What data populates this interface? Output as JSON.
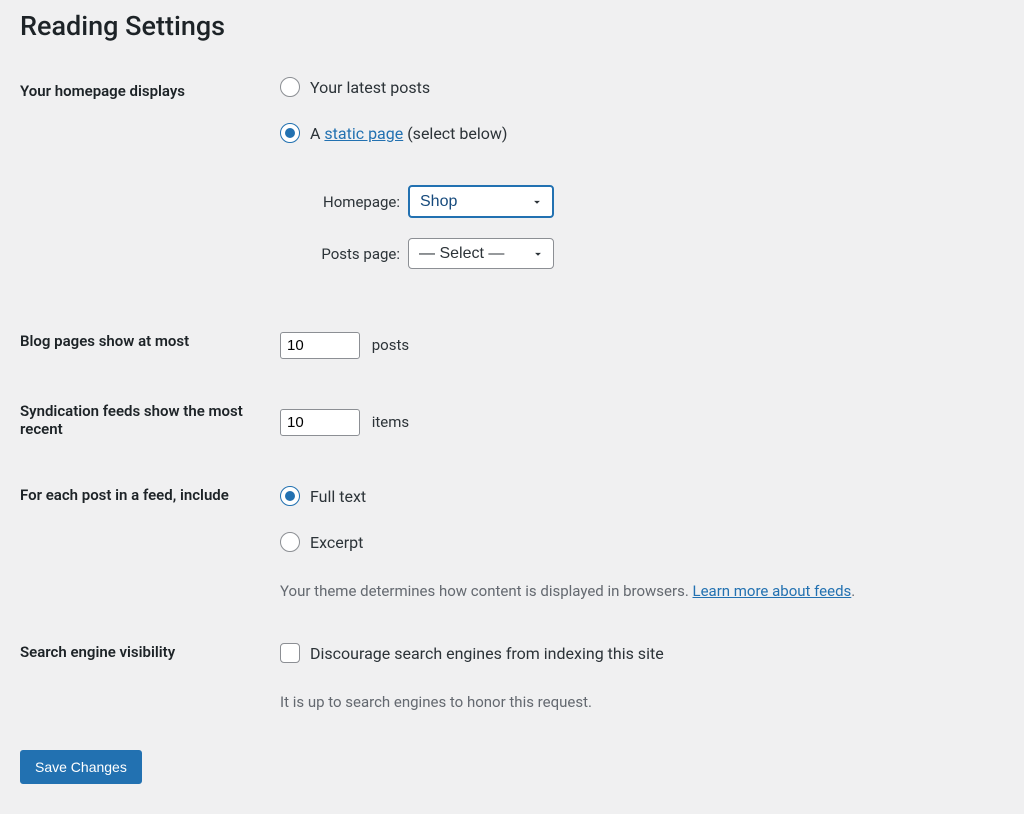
{
  "page_title": "Reading Settings",
  "homepage": {
    "label": "Your homepage displays",
    "option_latest": "Your latest posts",
    "option_static_prefix": "A ",
    "option_static_link": "static page",
    "option_static_suffix": " (select below)",
    "homepage_label": "Homepage:",
    "homepage_value": "Shop",
    "postspage_label": "Posts page:",
    "postspage_value": "— Select —"
  },
  "blog_pages": {
    "label": "Blog pages show at most",
    "value": "10",
    "unit": "posts"
  },
  "syndication": {
    "label": "Syndication feeds show the most recent",
    "value": "10",
    "unit": "items"
  },
  "feed_content": {
    "label": "For each post in a feed, include",
    "option_full": "Full text",
    "option_excerpt": "Excerpt",
    "desc_prefix": "Your theme determines how content is displayed in browsers. ",
    "desc_link": "Learn more about feeds",
    "desc_suffix": "."
  },
  "search_visibility": {
    "label": "Search engine visibility",
    "checkbox_label": "Discourage search engines from indexing this site",
    "description": "It is up to search engines to honor this request."
  },
  "submit_label": "Save Changes"
}
